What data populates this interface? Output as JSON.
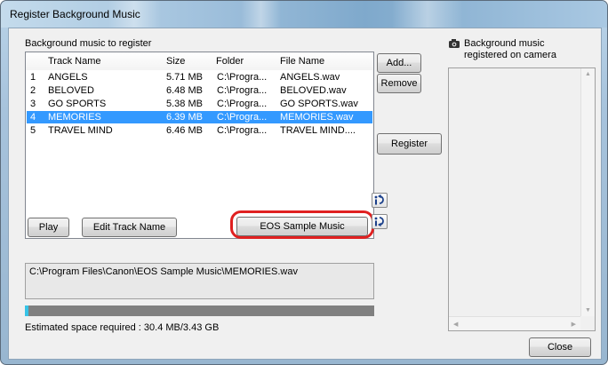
{
  "window": {
    "title": "Register Background Music"
  },
  "left_panel": {
    "heading": "Background music to register",
    "columns": [
      "",
      "Track Name",
      "Size",
      "Folder",
      "File Name"
    ],
    "tracks": [
      {
        "num": "1",
        "name": "ANGELS",
        "size": "5.71 MB",
        "folder": "C:\\Progra...",
        "file": "ANGELS.wav",
        "selected": false
      },
      {
        "num": "2",
        "name": "BELOVED",
        "size": "6.48 MB",
        "folder": "C:\\Progra...",
        "file": "BELOVED.wav",
        "selected": false
      },
      {
        "num": "3",
        "name": "GO SPORTS",
        "size": "5.38 MB",
        "folder": "C:\\Progra...",
        "file": "GO SPORTS.wav",
        "selected": false
      },
      {
        "num": "4",
        "name": "MEMORIES",
        "size": "6.39 MB",
        "folder": "C:\\Progra...",
        "file": "MEMORIES.wav",
        "selected": true
      },
      {
        "num": "5",
        "name": "TRAVEL MIND",
        "size": "6.46 MB",
        "folder": "C:\\Progra...",
        "file": "TRAVEL MIND....",
        "selected": false
      }
    ],
    "play_label": "Play",
    "edit_track_name_label": "Edit Track Name",
    "eos_sample_music_label": "EOS Sample Music",
    "selected_path": "C:\\Program Files\\Canon\\EOS Sample Music\\MEMORIES.wav",
    "estimate_text": "Estimated space required : 30.4 MB/3.43 GB"
  },
  "middle_buttons": {
    "add_label": "Add...",
    "remove_label": "Remove",
    "register_label": "Register"
  },
  "right_panel": {
    "heading_line1": "Background music",
    "heading_line2": "registered on camera",
    "close_label": "Close"
  }
}
